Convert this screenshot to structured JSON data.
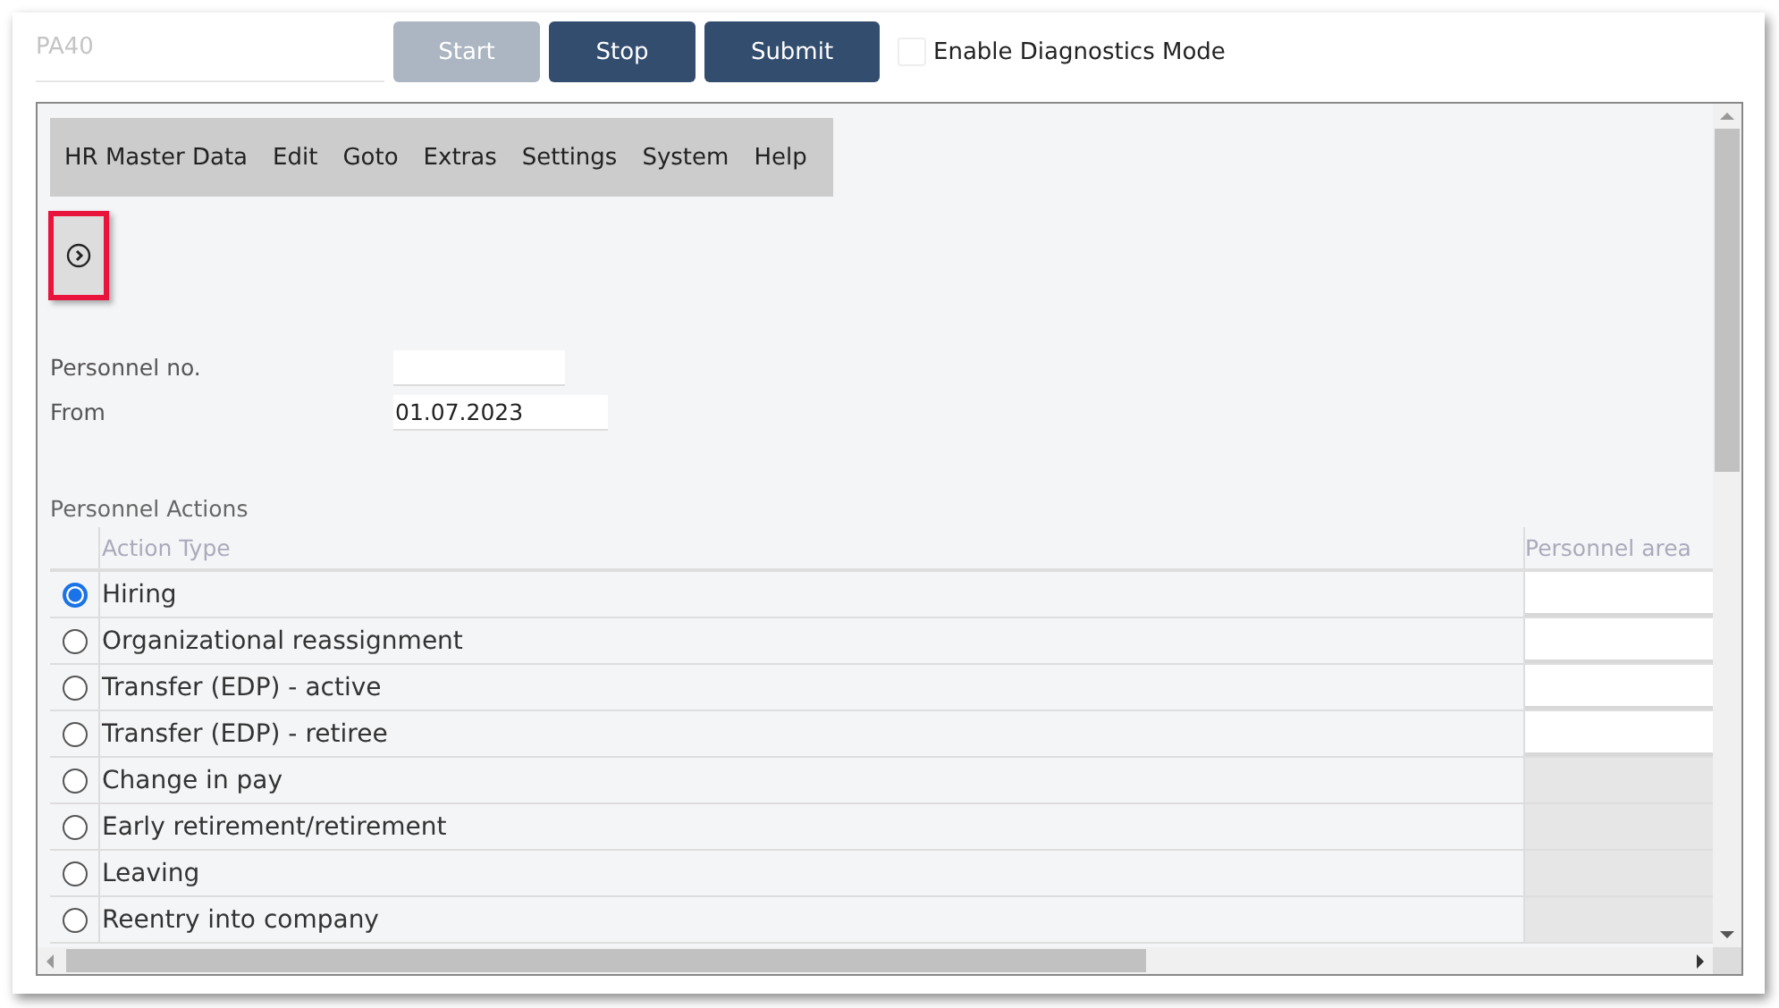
{
  "transaction_field": {
    "value": "PA40"
  },
  "buttons": [
    {
      "label": "Start",
      "disabled": true
    },
    {
      "label": "Stop",
      "disabled": false
    },
    {
      "label": "Submit",
      "disabled": false
    }
  ],
  "diagnostics": {
    "label": "Enable Diagnostics Mode",
    "checked": false
  },
  "menu": [
    "HR Master Data",
    "Edit",
    "Goto",
    "Extras",
    "Settings",
    "System",
    "Help"
  ],
  "fields": [
    {
      "label": "Personnel no."
    },
    {
      "label": "From",
      "value": "01.07.2023"
    }
  ],
  "section_title": "Personnel Actions",
  "table": {
    "columns": [
      "Action Type",
      "Personnel area"
    ],
    "rows": [
      {
        "action": "Hiring",
        "selected": true,
        "area_editable": true
      },
      {
        "action": "Organizational reassignment",
        "selected": false,
        "area_editable": true
      },
      {
        "action": "Transfer (EDP) - active",
        "selected": false,
        "area_editable": true
      },
      {
        "action": "Transfer (EDP) - retiree",
        "selected": false,
        "area_editable": true
      },
      {
        "action": "Change in pay",
        "selected": false,
        "area_editable": false
      },
      {
        "action": "Early retirement/retirement",
        "selected": false,
        "area_editable": false
      },
      {
        "action": "Leaving",
        "selected": false,
        "area_editable": false
      },
      {
        "action": "Reentry into company",
        "selected": false,
        "area_editable": false
      }
    ]
  }
}
